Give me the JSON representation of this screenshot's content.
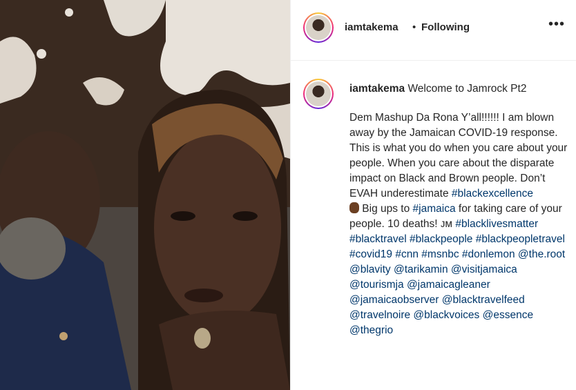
{
  "post": {
    "username": "iamtakema",
    "separator": "•",
    "follow_status": "Following",
    "more_icon": "•••"
  },
  "caption": {
    "username": "iamtakema",
    "title": "Welcome to Jamrock Pt2",
    "text_1": "Dem Mashup Da Rona Y’all!!!!!! I am blown away by the Jamaican COVID-19 response. This is what you do when you care about your people. When you care about the disparate impact on Black and Brown people. Don’t EVAH underestimate ",
    "tag_1": "#blackexcellence",
    "emoji": "fist-emoji",
    "text_2": " Big ups to ",
    "tag_2": "#jamaica",
    "text_3": " for taking care of your people. 10 deaths! ᴊᴍ ",
    "tags": [
      "#blacklivesmatter",
      "#blacktravel",
      "#blackpeople",
      "#blackpeopletravel",
      "#covid19",
      "#cnn",
      "#msnbc",
      "#donlemon",
      "@the.root",
      "@blavity",
      "@tarikamin",
      "@visitjamaica",
      "@tourismja",
      "@jamaicagleaner",
      "@jamaicaobserver",
      "@blacktravelfeed",
      "@travelnoire",
      "@blackvoices",
      "@essence",
      "@thegrio"
    ]
  }
}
